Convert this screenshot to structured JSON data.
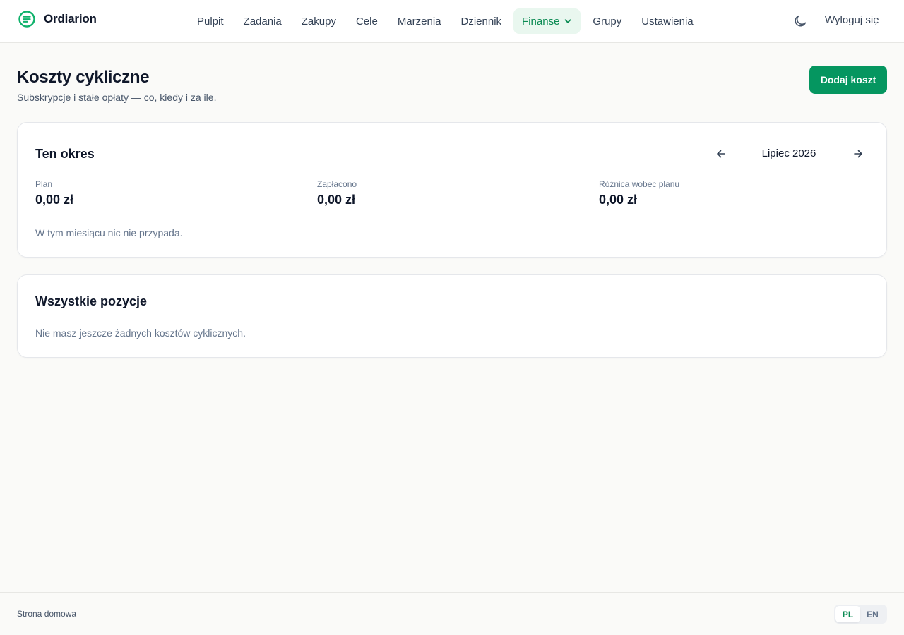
{
  "brand": {
    "name": "Ordiarion",
    "logo_icon": "list-circle-icon",
    "accent": "#10b26c"
  },
  "nav": {
    "items": [
      {
        "label": "Pulpit"
      },
      {
        "label": "Zadania"
      },
      {
        "label": "Zakupy"
      },
      {
        "label": "Cele"
      },
      {
        "label": "Marzenia"
      },
      {
        "label": "Dziennik"
      },
      {
        "label": "Finanse",
        "active": true,
        "has_dropdown": true
      },
      {
        "label": "Grupy"
      },
      {
        "label": "Ustawienia"
      }
    ]
  },
  "header": {
    "theme_icon": "moon-icon",
    "logout_label": "Wyloguj się"
  },
  "page": {
    "title": "Koszty cykliczne",
    "subtitle": "Subskrypcje i stałe opłaty — co, kiedy i za ile.",
    "add_button_label": "Dodaj koszt",
    "primary_color": "#059660"
  },
  "period_card": {
    "title": "Ten okres",
    "period_label": "Lipiec 2026",
    "prev_icon": "arrow-left-icon",
    "next_icon": "arrow-right-icon",
    "stats": [
      {
        "label": "Plan",
        "value": "0,00 zł"
      },
      {
        "label": "Zapłacono",
        "value": "0,00 zł"
      },
      {
        "label": "Różnica wobec planu",
        "value": "0,00 zł"
      }
    ],
    "empty_message": "W tym miesiącu nic nie przypada."
  },
  "all_card": {
    "title": "Wszystkie pozycje",
    "empty_message": "Nie masz jeszcze żadnych kosztów cyklicznych."
  },
  "footer": {
    "home_link": "Strona domowa",
    "languages": [
      {
        "code": "PL",
        "active": true
      },
      {
        "code": "EN",
        "active": false
      }
    ]
  }
}
